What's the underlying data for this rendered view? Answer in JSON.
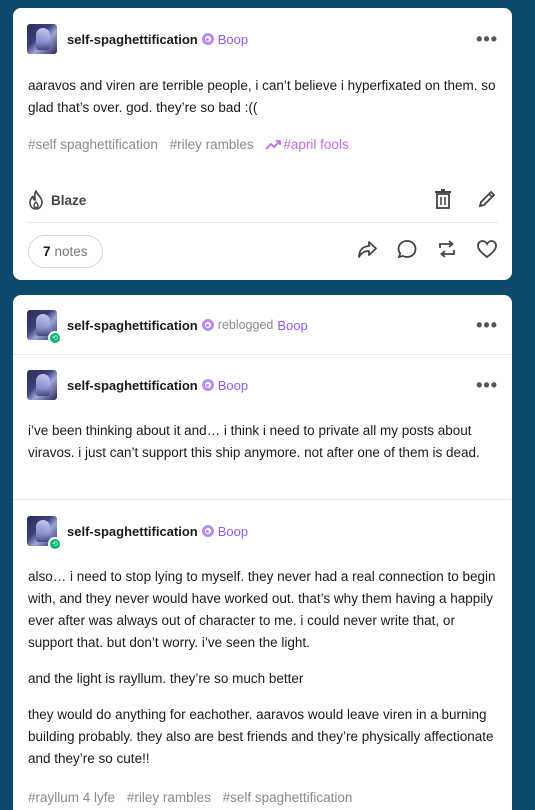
{
  "post1": {
    "username": "self-spaghettification",
    "boop_label": "Boop",
    "body": "aaravos and viren are terrible people, i can’t believe i hyperfixated on them. so glad that’s over. god. they’re so bad :((",
    "tags": [
      "#self spaghettification",
      "#riley rambles"
    ],
    "trending_tag": "#april fools",
    "blaze_label": "Blaze",
    "notes_count": "7",
    "notes_label": "notes",
    "icons": [
      "flame-icon",
      "trash-icon",
      "pencil-icon",
      "share-icon",
      "reply-icon",
      "reblog-icon",
      "heart-icon"
    ],
    "colors": {
      "trending": "#c46be8",
      "boop": "#8b5cf6"
    }
  },
  "post2": {
    "reblog_header": {
      "username": "self-spaghettification",
      "reblogged_text": "reblogged",
      "reblogged_from": "Boop"
    },
    "entry1": {
      "username": "self-spaghettification",
      "boop_label": "Boop",
      "body": "i’ve been thinking about it and… i think i need to private all my posts about viravos. i just can’t support this ship anymore. not after one of them is dead."
    },
    "entry2": {
      "username": "self-spaghettification",
      "boop_label": "Boop",
      "paragraphs": [
        "also… i need to stop lying to myself. they never had a real connection to begin with, and they never would have worked out. that’s why them having a happily ever after was always out of character to me. i could never write that, or support that. but don’t worry. i’ve seen the light.",
        "and the light is rayllum. they’re so much better",
        "they would do anything for eachother. aaravos would leave viren in a burning building probably. they also are best friends and they’re physically affectionate and they’re so cute!!"
      ],
      "tags": [
        "#rayllum 4 lyfe",
        "#riley rambles",
        "#self spaghettification"
      ]
    },
    "colors": {
      "reblog_badge": "#00b86b"
    }
  },
  "page_colors": {
    "background": "#0b4a6b",
    "card": "#ffffff"
  }
}
